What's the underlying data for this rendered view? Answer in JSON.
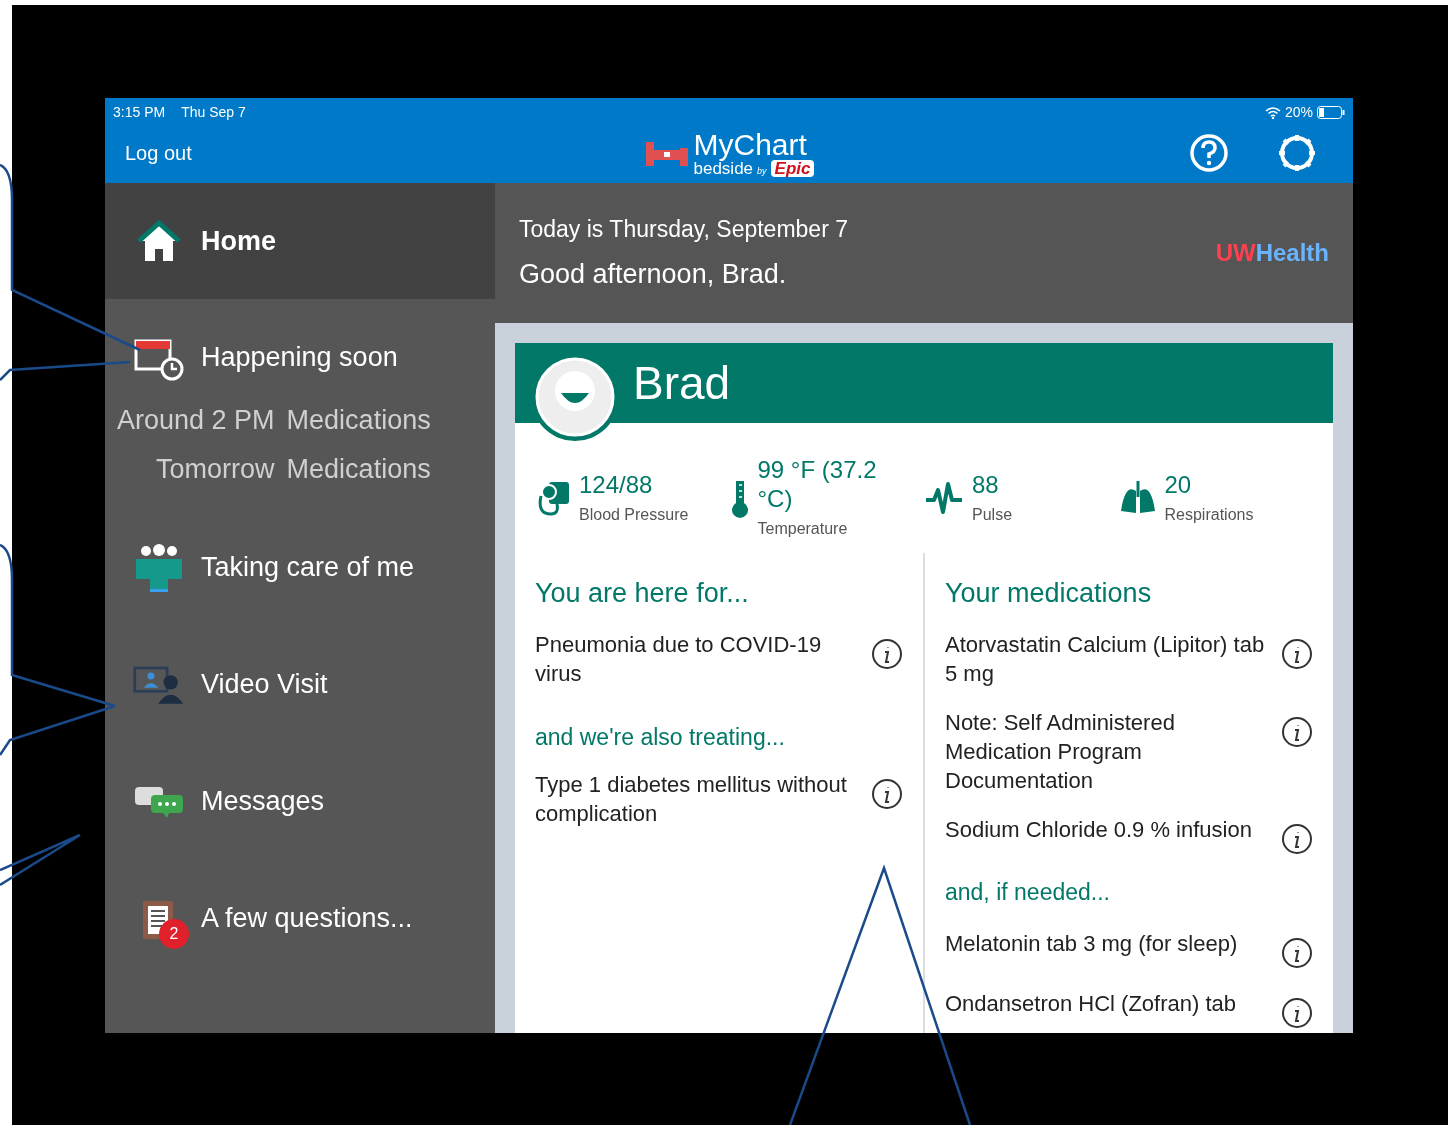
{
  "status_bar": {
    "time": "3:15 PM",
    "date": "Thu Sep 7",
    "battery": "20%"
  },
  "top_bar": {
    "logout": "Log out",
    "logo_title": "MyChart",
    "logo_sub": "bedside",
    "logo_by": "by",
    "logo_brand": "Epic"
  },
  "sidebar": {
    "items": [
      {
        "kind": "home",
        "label": "Home",
        "selected": true
      },
      {
        "kind": "soon",
        "label": "Happening soon",
        "selected": false,
        "events": [
          {
            "time": "Around 2 PM",
            "title": "Medications"
          },
          {
            "time": "Tomorrow",
            "title": "Medications"
          }
        ]
      },
      {
        "kind": "team",
        "label": "Taking care of me",
        "selected": false
      },
      {
        "kind": "video",
        "label": "Video Visit",
        "selected": false
      },
      {
        "kind": "messages",
        "label": "Messages",
        "selected": false
      },
      {
        "kind": "questions",
        "label": "A few questions...",
        "selected": false,
        "badge": "2"
      }
    ]
  },
  "header": {
    "date_line": "Today is Thursday, September 7",
    "greeting": "Good afternoon, Brad.",
    "brand_a": "UW",
    "brand_b": "Health"
  },
  "patient": {
    "name": "Brad",
    "vitals": [
      {
        "kind": "bp",
        "value": "124/88",
        "label": "Blood Pressure"
      },
      {
        "kind": "temp",
        "value": "99 °F (37.2 °C)",
        "label": "Temperature"
      },
      {
        "kind": "pulse",
        "value": "88",
        "label": "Pulse"
      },
      {
        "kind": "resp",
        "value": "20",
        "label": "Respirations"
      }
    ],
    "here_for": {
      "title": "You are here for...",
      "items": [
        "Pneumonia due to COVID-19 virus"
      ],
      "also_title": "and we're also treating...",
      "also_items": [
        "Type 1 diabetes mellitus without complication"
      ]
    },
    "medications": {
      "title": "Your medications",
      "items": [
        "Atorvastatin Calcium (Lipitor) tab 5 mg",
        "Note: Self Administered Medication Program Documentation",
        "Sodium Chloride 0.9 % infusion"
      ],
      "prn_title": "and, if needed...",
      "prn_items": [
        "Melatonin tab 3 mg (for sleep)",
        "Ondansetron HCl (Zofran) tab"
      ]
    }
  }
}
